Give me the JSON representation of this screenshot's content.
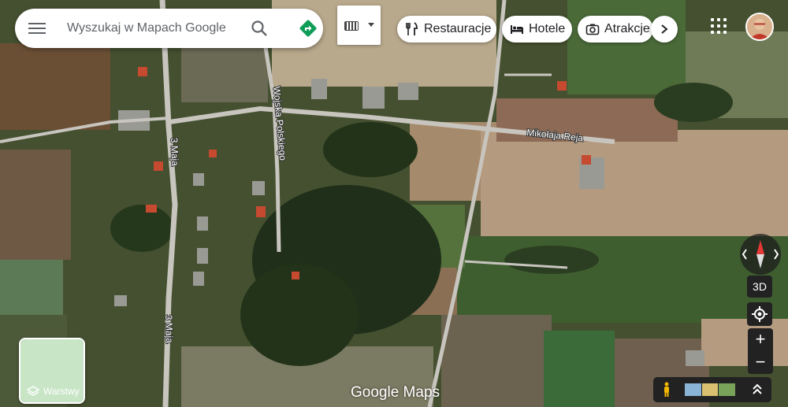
{
  "search": {
    "placeholder": "Wyszukaj w Mapach Google"
  },
  "chips": [
    {
      "label": "Restauracje",
      "icon": "fork-knife-icon"
    },
    {
      "label": "Hotele",
      "icon": "bed-icon"
    },
    {
      "label": "Atrakcje",
      "icon": "camera-icon"
    }
  ],
  "roads": {
    "road_3maja_upper": "3 Maja",
    "road_3maja_lower": "3 Maja",
    "road_wojska": "Wojska Polskiego",
    "road_mikolaja": "Mikołaja Reja"
  },
  "controls": {
    "threed_label": "3D",
    "zoom_in": "+",
    "zoom_out": "−"
  },
  "layers": {
    "label": "Warstwy"
  },
  "brand": {
    "text": "Google Maps"
  },
  "colors": {
    "accent_blue": "#1a73e8",
    "directions_green": "#0f9d58",
    "compass_red": "#e53935"
  },
  "icons": [
    "menu-icon",
    "search-icon",
    "directions-icon",
    "keyboard-icon",
    "apps-grid-icon",
    "avatar",
    "compass-icon",
    "locate-icon",
    "layers-icon",
    "pegman-icon",
    "expand-icon"
  ]
}
